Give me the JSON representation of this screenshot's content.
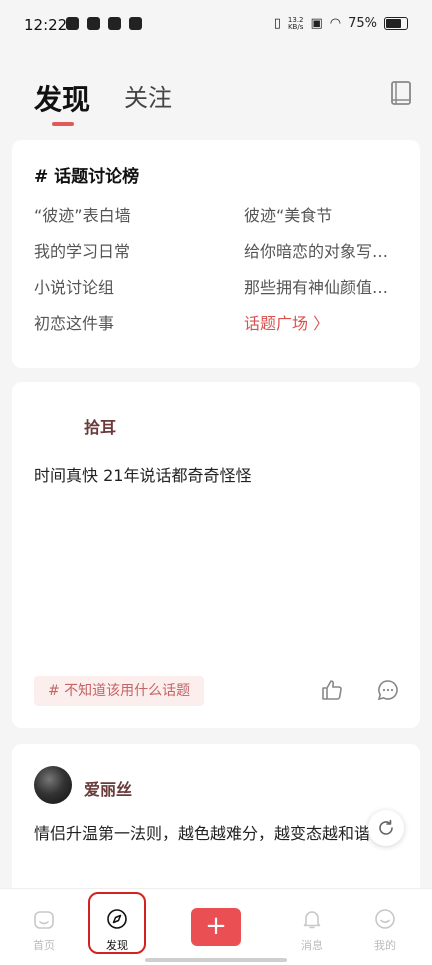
{
  "status_bar": {
    "time": "12:22",
    "net_speed_value": "13.2",
    "net_speed_unit": "KB/s",
    "battery": "75%"
  },
  "header": {
    "tabs": [
      {
        "label": "发现",
        "active": true
      },
      {
        "label": "关注",
        "active": false
      }
    ],
    "icon": "book-icon"
  },
  "topic_board": {
    "title": "# 话题讨论榜",
    "left": [
      "“彼迹”表白墙",
      "我的学习日常",
      "小说讨论组",
      "初恋这件事"
    ],
    "right": [
      "彼迹“美食节",
      "给你暗恋的对象写…",
      "那些拥有神仙颜值…",
      "话题广场 〉"
    ]
  },
  "posts": [
    {
      "author": "拾耳",
      "text": "时间真快 21年说话都奇奇怪怪",
      "tag": "# 不知道该用什么话题"
    },
    {
      "author": "爱丽丝",
      "text": "情侣升温第一法则，越色越难分，越变态越和谐!"
    }
  ],
  "tabbar": {
    "items": [
      {
        "label": "首页",
        "icon": "home-icon"
      },
      {
        "label": "发现",
        "icon": "compass-icon"
      },
      {
        "label": "+",
        "icon": "plus-icon"
      },
      {
        "label": "消息",
        "icon": "bell-icon"
      },
      {
        "label": "我的",
        "icon": "profile-icon"
      }
    ]
  },
  "colors": {
    "accent": "#ea4f53",
    "highlight_box": "#d32222",
    "link": "#d9524e"
  }
}
